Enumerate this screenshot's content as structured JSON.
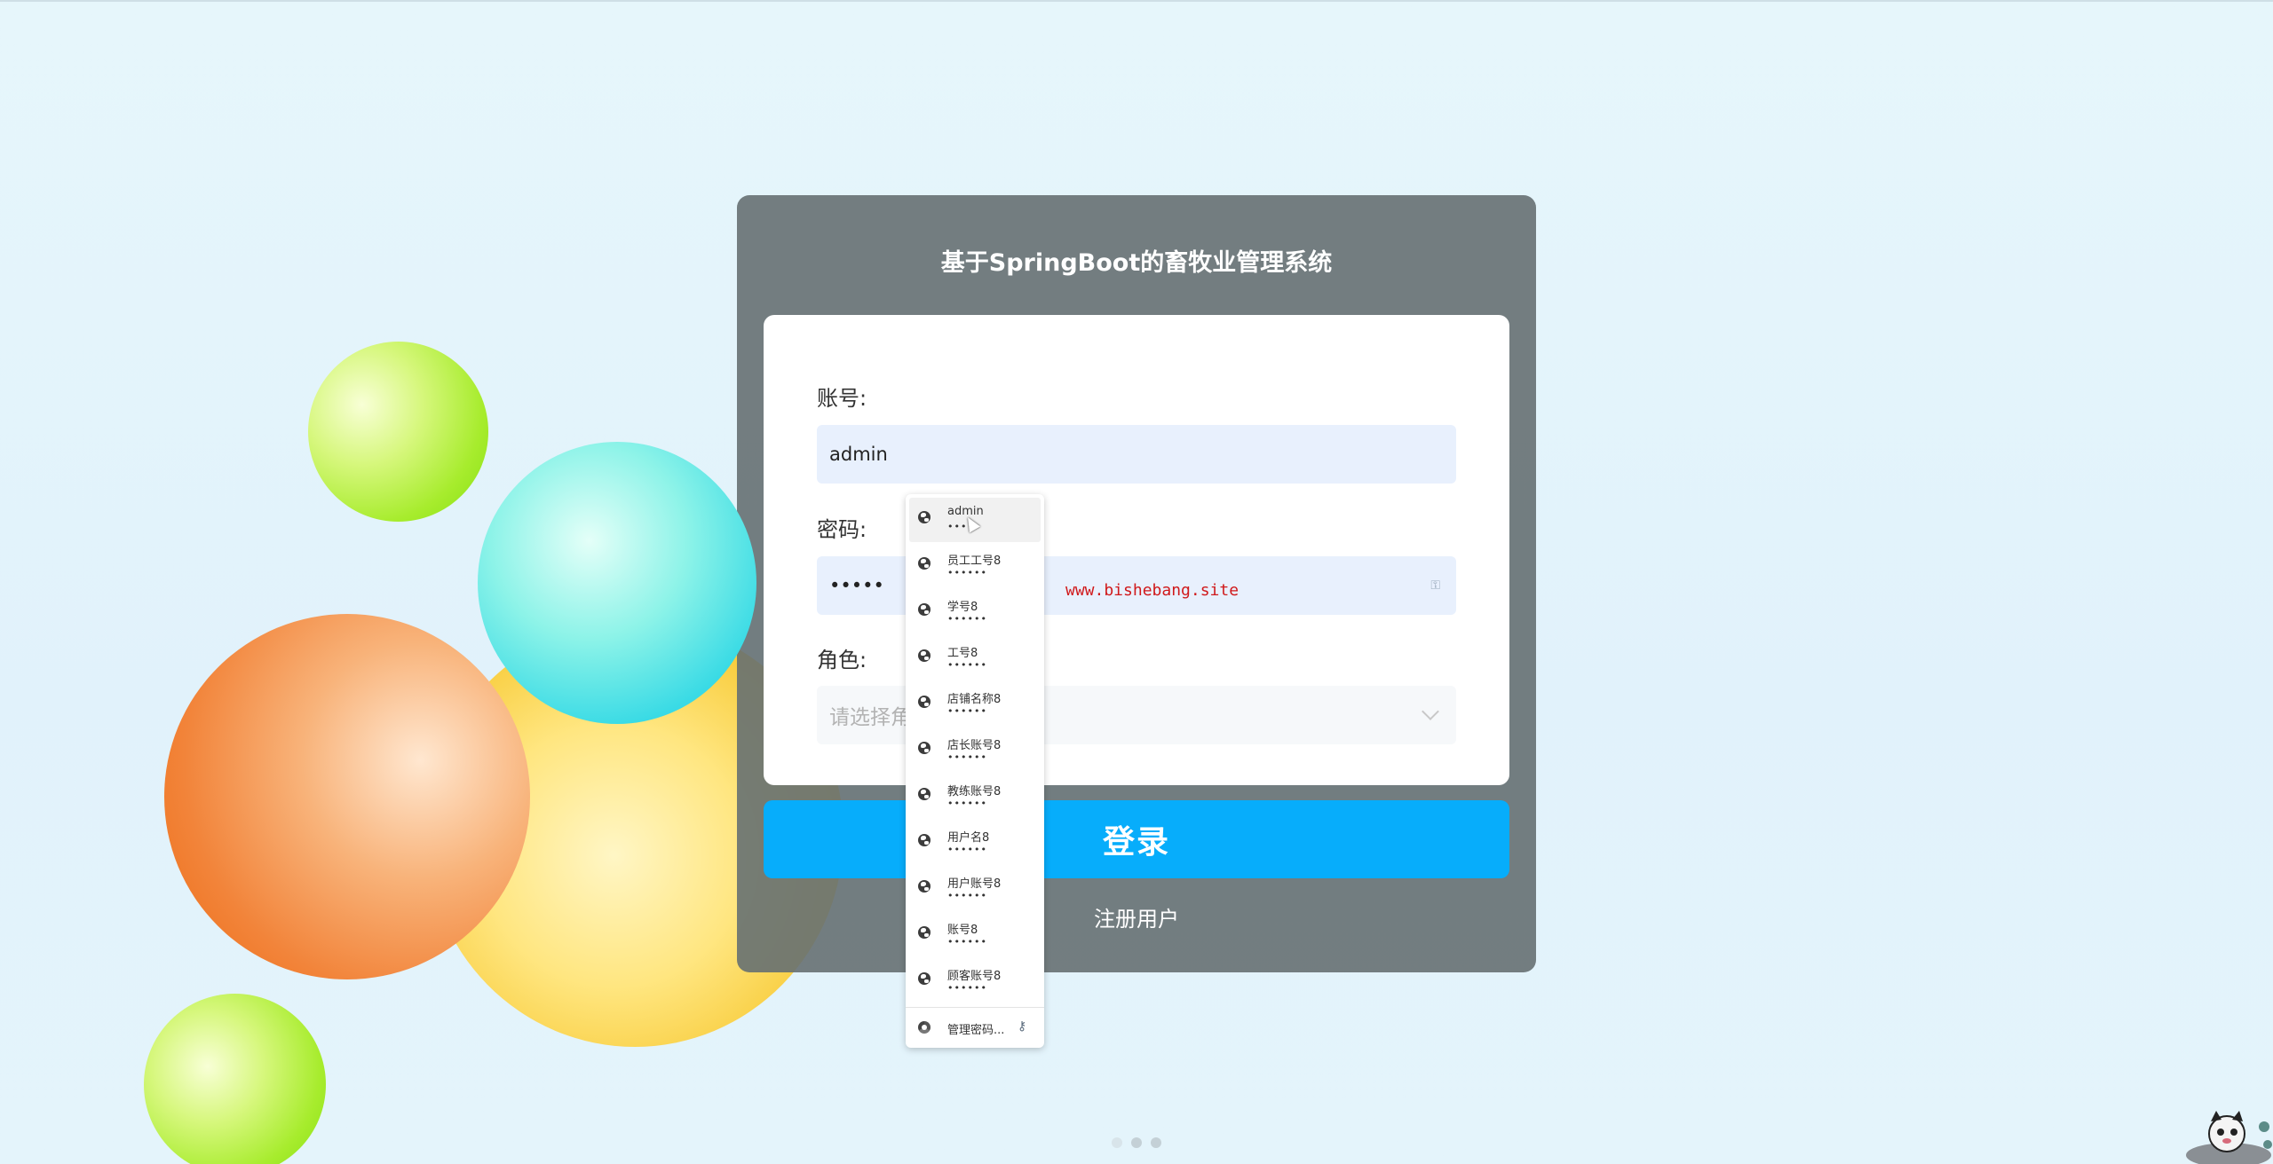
{
  "app": {
    "title": "基于SpringBoot的畜牧业管理系统"
  },
  "form": {
    "account_label": "账号:",
    "account_value": "admin",
    "password_label": "密码:",
    "password_value": "•••••",
    "role_label": "角色:",
    "role_placeholder": "请选择角色",
    "login_button": "登录",
    "register_link": "注册用户"
  },
  "watermark": "www.bishebang.site",
  "autofill": {
    "items": [
      {
        "username": "admin",
        "password": "•••••"
      },
      {
        "username": "员工工号8",
        "password": "••••••"
      },
      {
        "username": "学号8",
        "password": "••••••"
      },
      {
        "username": "工号8",
        "password": "••••••"
      },
      {
        "username": "店铺名称8",
        "password": "••••••"
      },
      {
        "username": "店长账号8",
        "password": "••••••"
      },
      {
        "username": "教练账号8",
        "password": "••••••"
      },
      {
        "username": "用户名8",
        "password": "••••••"
      },
      {
        "username": "用户账号8",
        "password": "••••••"
      },
      {
        "username": "账号8",
        "password": "••••••"
      },
      {
        "username": "顾客账号8",
        "password": "••••••"
      }
    ],
    "manage_label": "管理密码..."
  },
  "colors": {
    "login_button": "#07adfb",
    "panel": "#667072",
    "watermark": "#d0191b"
  }
}
